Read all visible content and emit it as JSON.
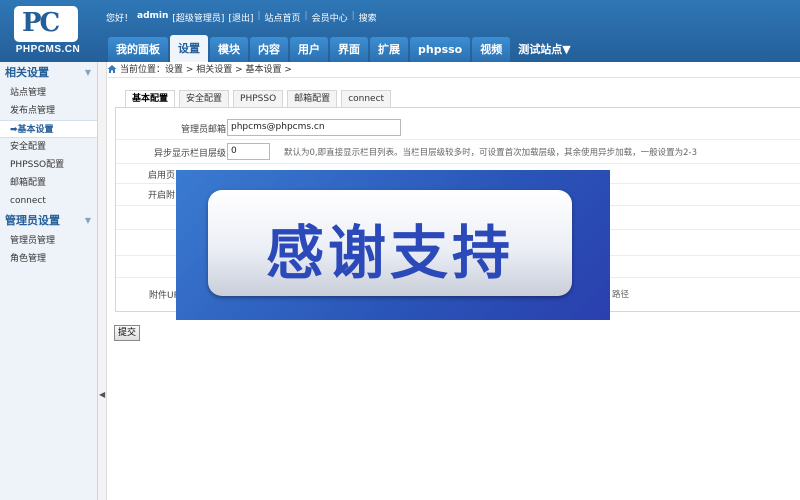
{
  "brand": {
    "logo": "PC",
    "name": "PHPCMS.CN"
  },
  "toplinks": {
    "greeting": "您好！",
    "user": "admin",
    "role": "[超级管理员]",
    "logout": "[退出]",
    "site_home": "站点首页",
    "member_center": "会员中心",
    "search": "搜索"
  },
  "nav": {
    "tabs": [
      "我的面板",
      "设置",
      "模块",
      "内容",
      "用户",
      "界面",
      "扩展",
      "phpsso",
      "视频"
    ],
    "active": "设置",
    "site_switch": "测试站点▼"
  },
  "sidebar": {
    "group1": {
      "title": "相关设置",
      "items": [
        "站点管理",
        "发布点管理",
        "基本设置",
        "安全配置",
        "PHPSSO配置",
        "邮箱配置",
        "connect"
      ]
    },
    "group2": {
      "title": "管理员设置",
      "items": [
        "管理员管理",
        "角色管理"
      ]
    },
    "active_item": "基本设置",
    "active_marker": "➡"
  },
  "breadcrumb": "当前位置：设置 > 相关设置 > 基本设置 >",
  "tabs": [
    "基本配置",
    "安全配置",
    "PHPSSO",
    "邮箱配置",
    "connect"
  ],
  "form": {
    "admin_email": {
      "label": "管理员邮箱",
      "value": "phpcms@phpcms.cn"
    },
    "async_level": {
      "label": "异步显示栏目层级",
      "value": "0",
      "hint": "默认为0,即直接显示栏目列表。当栏目层级较多时，可设置首次加载层级，其余使用异步加载，一般设置为2-3"
    },
    "row3_label": "启用页",
    "row4_label": "开启附",
    "attach_label": "附件UR",
    "attach_hint": "路径"
  },
  "submit_label": "提交",
  "overlay": {
    "text": "感谢支持"
  },
  "collapse_icon": "◀"
}
